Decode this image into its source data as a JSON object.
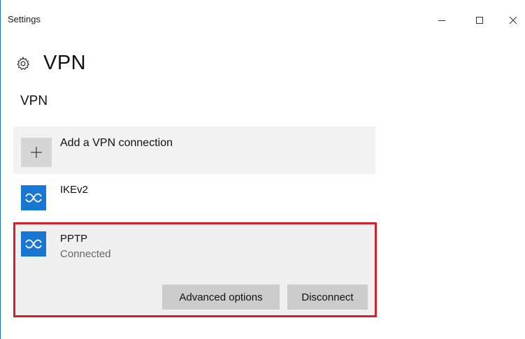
{
  "window": {
    "title": "Settings",
    "controls": [
      "minimize-icon",
      "maximize-icon",
      "close-icon"
    ]
  },
  "header": {
    "icon": "gear-icon",
    "title": "VPN"
  },
  "section": {
    "title": "VPN"
  },
  "add_connection": {
    "icon": "plus-icon",
    "label": "Add a VPN connection"
  },
  "connections": [
    {
      "name": "IKEv2",
      "status": "",
      "icon": "vpn-icon"
    },
    {
      "name": "PPTP",
      "status": "Connected",
      "icon": "vpn-icon",
      "selected": true
    }
  ],
  "actions": {
    "advanced_label": "Advanced options",
    "disconnect_label": "Disconnect"
  },
  "colors": {
    "accent": "#1877d2",
    "highlight_border": "#d3202a",
    "row_bg": "#f2f2f2",
    "button_bg": "#cccccc"
  }
}
